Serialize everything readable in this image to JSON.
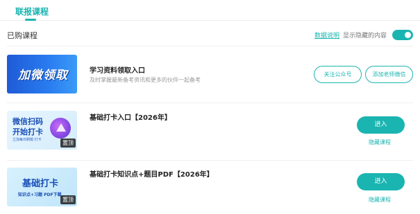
{
  "tabs": {
    "active_label": "联报课程"
  },
  "section": {
    "title": "已购课程",
    "data_link": "数据说明",
    "show_hidden_label": "显示隐藏的内容",
    "show_hidden_on": true
  },
  "courses": [
    {
      "thumb_text": "加微领取",
      "title": "学习资料领取入口",
      "subtitle": "及时掌握最新备考资讯和更多的伙伴一起备考",
      "actions": [
        "关注公众号",
        "添加老师微信"
      ]
    },
    {
      "thumb_lines": [
        "微信扫码",
        "开始打卡",
        "立加每日刷题 打卡"
      ],
      "badge": "置顶",
      "title": "基础打卡入口【2026年】",
      "enter_label": "进入",
      "hide_label": "隐藏课程"
    },
    {
      "thumb_lines": [
        "基础打卡",
        "知识点+习题 PDF下载"
      ],
      "badge": "置顶",
      "title": "基础打卡知识点+题目PDF【2026年】",
      "enter_label": "进入",
      "hide_label": "隐藏课程"
    }
  ],
  "colors": {
    "accent": "#1bb5b1"
  }
}
